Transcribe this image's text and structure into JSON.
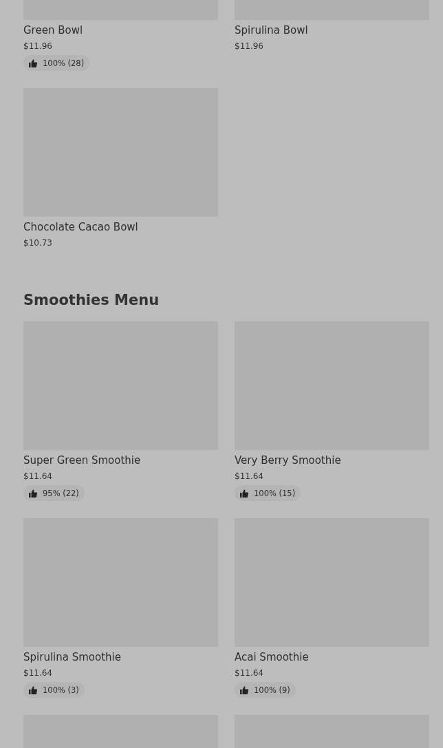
{
  "sections": [
    {
      "items": [
        {
          "kind": "item",
          "name": "Green Bowl",
          "price": "$11.96",
          "rating": "100% (28)"
        },
        {
          "kind": "item",
          "name": "Spirulina Bowl",
          "price": "$11.96"
        },
        {
          "kind": "item",
          "name": "Chocolate Cacao Bowl",
          "price": "$10.73"
        }
      ]
    },
    {
      "title": "Smoothies Menu",
      "items": [
        {
          "kind": "item",
          "name": "Super Green Smoothie",
          "price": "$11.64",
          "rating": "95% (22)"
        },
        {
          "kind": "item",
          "name": "Very Berry Smoothie",
          "price": "$11.64",
          "rating": "100% (15)"
        },
        {
          "kind": "item",
          "name": "Spirulina Smoothie",
          "price": "$11.64",
          "rating": "100% (3)"
        },
        {
          "kind": "item",
          "name": "Acai Smoothie",
          "price": "$11.64",
          "rating": "100% (9)"
        },
        {
          "kind": "image-only"
        },
        {
          "kind": "image-only"
        }
      ]
    }
  ]
}
